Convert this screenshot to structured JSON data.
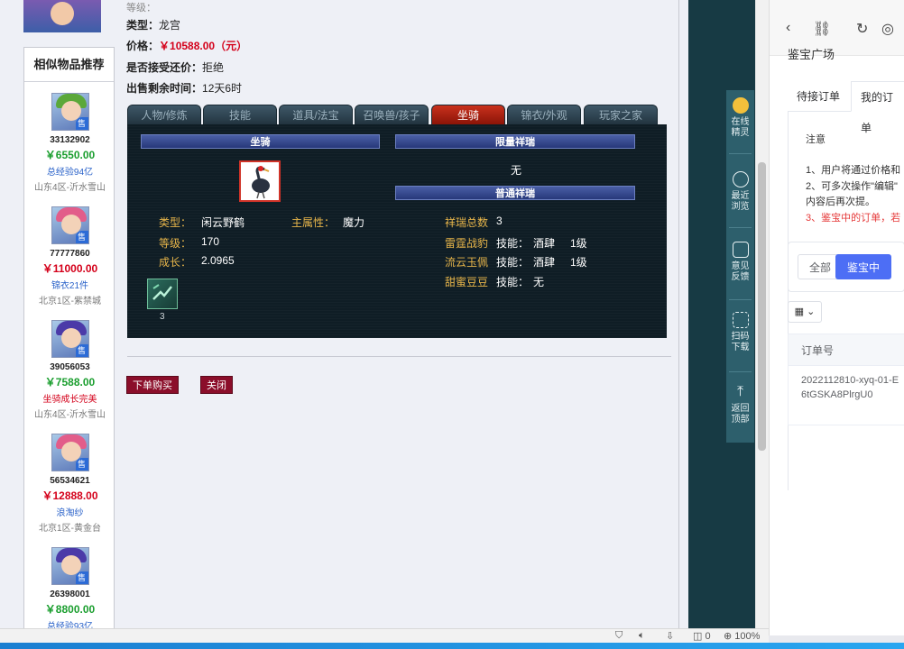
{
  "top_partial_text": "等级：",
  "item": {
    "type_label": "类型：",
    "type_value": "龙宫",
    "price_label": "价格：",
    "price_value": "￥10588.00（元）",
    "bargain_label": "是否接受还价：",
    "bargain_value": "拒绝",
    "remaining_label": "出售剩余时间：",
    "remaining_value": "12天6时"
  },
  "similar": {
    "title": "相似物品推荐",
    "items": [
      {
        "id": "33132902",
        "price": "￥6550.00",
        "price_color": "#1a9e2e",
        "tag": "总经验94亿",
        "tag_color": "#2a62c9",
        "server": "山东4区-沂水雪山",
        "sell": "售",
        "hair": "#5ba83a"
      },
      {
        "id": "77777860",
        "price": "￥11000.00",
        "price_color": "#d4001a",
        "tag": "锦衣21件",
        "tag_color": "#2a62c9",
        "server": "北京1区-紫禁城",
        "sell": "售",
        "hair": "#e25d8a"
      },
      {
        "id": "39056053",
        "price": "￥7588.00",
        "price_color": "#1a9e2e",
        "tag": "坐骑成长完美",
        "tag_color": "#d4001a",
        "server": "山东4区-沂水雪山",
        "sell": "售",
        "hair": "#4b3aa8"
      },
      {
        "id": "56534621",
        "price": "￥12888.00",
        "price_color": "#d4001a",
        "tag": "浪淘纱",
        "tag_color": "#2a62c9",
        "server": "北京1区-黄金台",
        "sell": "售",
        "hair": "#e25d8a"
      },
      {
        "id": "26398001",
        "price": "￥8800.00",
        "price_color": "#1a9e2e",
        "tag": "总经验93亿",
        "tag_color": "#2a62c9",
        "server": "",
        "sell": "售",
        "hair": "#4b3aa8"
      }
    ]
  },
  "tabs": [
    "人物/修炼",
    "技能",
    "道具/法宝",
    "召唤兽/孩子",
    "坐骑",
    "锦衣/外观",
    "玩家之家"
  ],
  "active_tab": "坐骑",
  "mount": {
    "header": "坐骑",
    "type_label": "类型：",
    "type_value": "闲云野鹤",
    "main_attr_label": "主属性：",
    "main_attr_value": "魔力",
    "level_label": "等级：",
    "level_value": "170",
    "growth_label": "成长：",
    "growth_value": "2.0965",
    "skill_count": "3"
  },
  "limited": {
    "header": "限量祥瑞",
    "value": "无"
  },
  "normal": {
    "header": "普通祥瑞",
    "total_label": "祥瑞总数",
    "total_value": "3",
    "rows": [
      {
        "name": "雷霆战豹",
        "skill_label": "技能：",
        "skill": "酒肆",
        "level": "1级"
      },
      {
        "name": "流云玉佩",
        "skill_label": "技能：",
        "skill": "酒肆",
        "level": "1级"
      },
      {
        "name": "甜蜜豆豆",
        "skill_label": "技能：",
        "skill": "无",
        "level": ""
      }
    ]
  },
  "buttons": {
    "buy": "下单购买",
    "close": "关闭"
  },
  "float_bar": [
    {
      "label": "在线\n精灵"
    },
    {
      "label": "最近\n浏览"
    },
    {
      "label": "意见\n反馈"
    },
    {
      "label": "扫码\n下载"
    },
    {
      "label": "返回\n顶部"
    }
  ],
  "right_panel": {
    "title": "鉴宝广场",
    "watermark": "鉴宝广场",
    "tabs": [
      "待接订单",
      "我的订单"
    ],
    "active_tab": "我的订单",
    "notice_title": "注意",
    "notes": [
      "1、用户将通过价格和",
      "2、可多次操作\"编辑\"",
      "内容后再次提。",
      "3、鉴宝中的订单，若"
    ],
    "filters": [
      "全部",
      "鉴宝中"
    ],
    "active_filter": "鉴宝中",
    "grid_toggle": "▦ ⌄",
    "table_header": "订单号",
    "order_id": "2022112810-xyq-01-E6tGSKA8PlrgU0"
  },
  "status_bar": {
    "mute": "0",
    "zoom": "100%"
  },
  "colors": {
    "accent_red": "#d4001a",
    "active_tab": "#c9311c",
    "panel_bg": "#0f1d25",
    "primary_blue": "#4d6ef5"
  }
}
